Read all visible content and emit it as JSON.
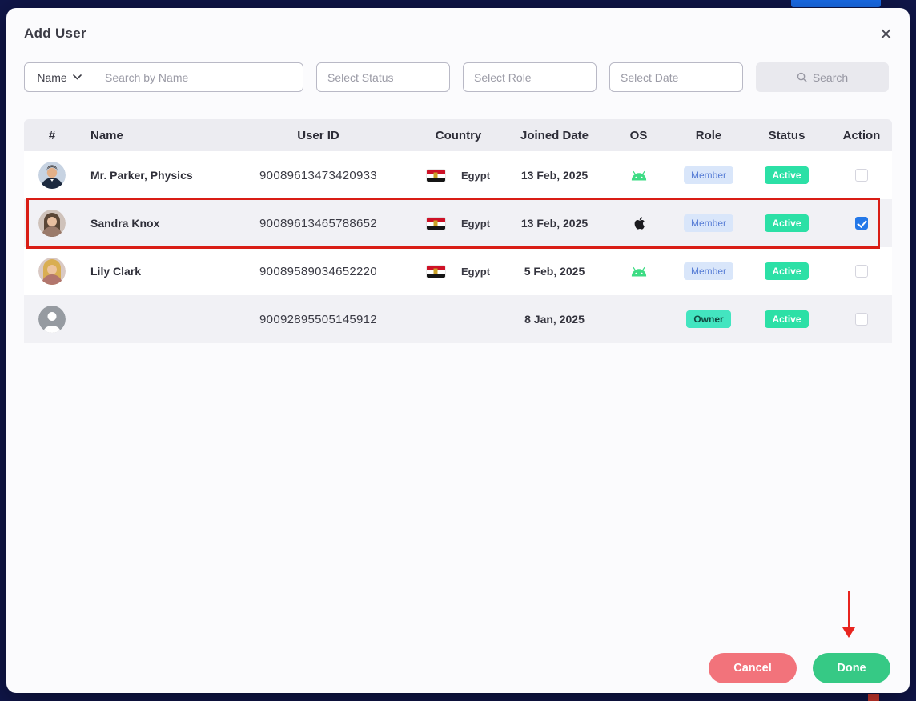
{
  "modal": {
    "title": "Add User",
    "close_icon": "×"
  },
  "filters": {
    "name_dropdown_label": "Name",
    "search_placeholder": "Search by Name",
    "status_placeholder": "Select Status",
    "role_placeholder": "Select Role",
    "date_placeholder": "Select Date",
    "search_button_label": "Search"
  },
  "table": {
    "headers": [
      "#",
      "Name",
      "User ID",
      "Country",
      "Joined Date",
      "OS",
      "Role",
      "Status",
      "Action"
    ],
    "rows": [
      {
        "name": "Mr. Parker, Physics",
        "user_id": "90089613473420933",
        "country": "Egypt",
        "joined": "13 Feb, 2025",
        "os": "android",
        "role": "Member",
        "status": "Active",
        "checked": false,
        "highlighted": false
      },
      {
        "name": "Sandra Knox",
        "user_id": "90089613465788652",
        "country": "Egypt",
        "joined": "13 Feb, 2025",
        "os": "apple",
        "role": "Member",
        "status": "Active",
        "checked": true,
        "highlighted": true
      },
      {
        "name": "Lily Clark",
        "user_id": "90089589034652220",
        "country": "Egypt",
        "joined": "5 Feb, 2025",
        "os": "android",
        "role": "Member",
        "status": "Active",
        "checked": false,
        "highlighted": false
      },
      {
        "name": "",
        "user_id": "90092895505145912",
        "country": "",
        "joined": "8 Jan, 2025",
        "os": "",
        "role": "Owner",
        "status": "Active",
        "checked": false,
        "highlighted": false
      }
    ]
  },
  "footer": {
    "cancel_label": "Cancel",
    "done_label": "Done"
  },
  "colors": {
    "accent_blue": "#2478e8",
    "active_green": "#2ce0a6",
    "owner_teal": "#43e5c0",
    "member_blue_bg": "#d9e6fa",
    "cancel_red": "#f2737b",
    "done_green": "#36c985",
    "annotation_red": "#d91d15",
    "background_navy": "#10164a"
  }
}
